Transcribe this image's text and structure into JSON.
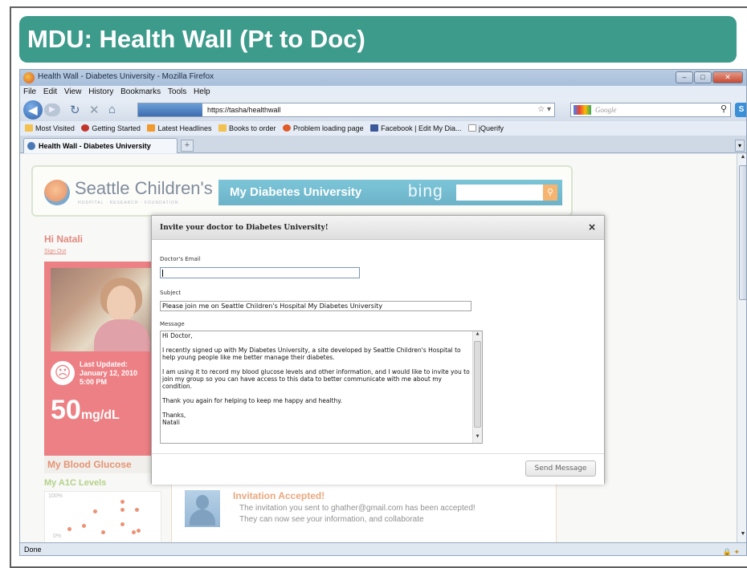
{
  "slide": {
    "title": "MDU: Health Wall (Pt to Doc)"
  },
  "browser": {
    "window_title": "Health Wall - Diabetes University - Mozilla Firefox",
    "menu": [
      "File",
      "Edit",
      "View",
      "History",
      "Bookmarks",
      "Tools",
      "Help"
    ],
    "url_badge": "tasha",
    "url": "https://tasha/healthwall",
    "search_placeholder": "Google",
    "bookmarks": [
      "Most Visited",
      "Getting Started",
      "Latest Headlines",
      "Books to order",
      "Problem loading page",
      "Facebook | Edit My Dia...",
      "jQuerify"
    ],
    "tab_label": "Health Wall - Diabetes University",
    "status": "Done"
  },
  "page": {
    "brand_name": "Seattle Children's",
    "brand_sub": "HOSPITAL · RESEARCH · FOUNDATION",
    "site_title": "My Diabetes University",
    "search_brand": "bing",
    "greeting": "Hi Natali",
    "sign_out": "Sign Out",
    "last_updated_label": "Last Updated:",
    "last_updated_date": "January 12, 2010",
    "last_updated_time": "5:00 PM",
    "glucose_value": "50",
    "glucose_unit": "mg/dL",
    "glucose_tab": "My Blood Glucose",
    "a1c_title": "My A1C Levels",
    "a1c_top": "100%",
    "a1c_bottom": "0%",
    "invite_title": "Invitation Accepted!",
    "invite_body": "The invitation you sent to ghather@gmail.com has been accepted! They can now see your information, and collaborate"
  },
  "modal": {
    "title": "Invite your doctor to Diabetes University!",
    "close": "×",
    "email_label": "Doctor's Email",
    "email_value": "",
    "subject_label": "Subject",
    "subject_value": "Please join me on Seattle Children's Hospital My Diabetes University",
    "message_label": "Message",
    "message_value": "Hi Doctor,\n\nI recently signed up with My Diabetes University, a site developed by Seattle Children's Hospital to help young people like me better manage their diabetes.\n\nI am using it to record my blood glucose levels and other information, and I would like to invite you to join my group so you can have access to this data to better communicate with me about my condition.\n\nThank you again for helping to keep me happy and healthy.\n\nThanks,\nNatali",
    "send_label": "Send Message"
  }
}
